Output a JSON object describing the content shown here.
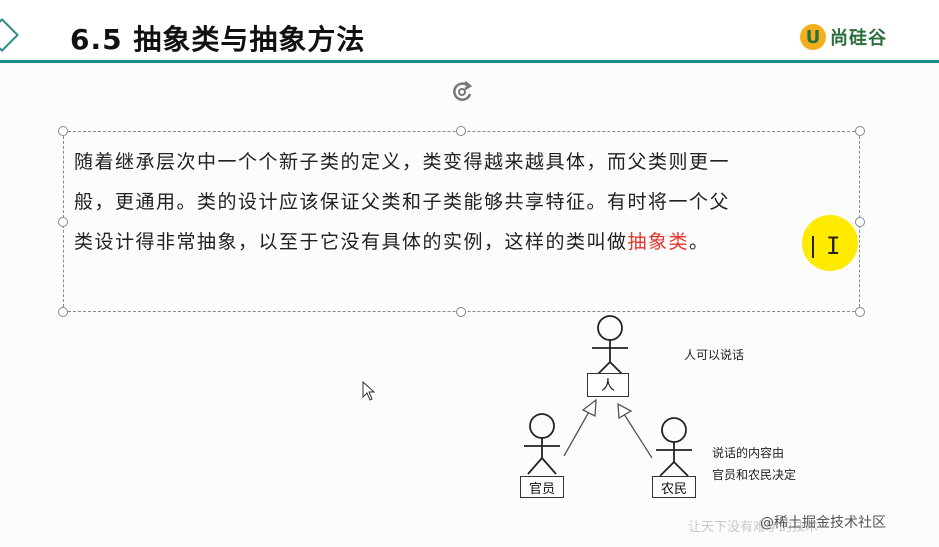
{
  "header": {
    "title": "6.5  抽象类与抽象方法",
    "logo_mark": "U",
    "logo_text": "尚硅谷"
  },
  "textbox": {
    "line1": "随着继承层次中一个个新子类的定义，类变得越来越具体，而父类则更一",
    "line2": "般，更通用。类的设计应该保证父类和子类能够共享特征。有时将一个父",
    "line3_prefix": "类设计得非常抽象，以至于它没有具体的实例，这样的类叫做",
    "line3_highlight": "抽象类",
    "line3_suffix": "。"
  },
  "diagram": {
    "person_label": "人",
    "official_label": "官员",
    "farmer_label": "农民",
    "note_top": "人可以说话",
    "note_bottom_1": "说话的内容由",
    "note_bottom_2": "官员和农民决定"
  },
  "watermark": "@稀土掘金技术社区",
  "faint_text": "让天下没有难学的技术",
  "colors": {
    "accent": "#1f8f86",
    "highlight": "#e8332a",
    "cursor": "#ffea00"
  }
}
